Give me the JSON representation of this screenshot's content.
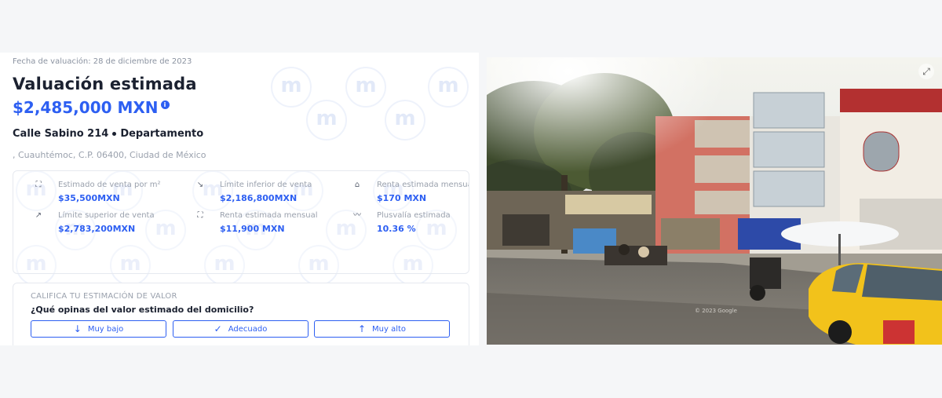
{
  "valuation": {
    "date_label": "Fecha de valuación: 28 de diciembre de 2023",
    "title": "Valuación estimada",
    "price": "$2,485,000 MXN",
    "info_icon": "i"
  },
  "property": {
    "street": "Calle Sabino 214",
    "type": "Departamento",
    "location": ", Cuauhtémoc, C.P. 06400, Ciudad de México"
  },
  "stats": [
    {
      "icon": "scan-icon",
      "glyph": "⛶",
      "label": "Estimado de venta por m²",
      "value": "$35,500MXN"
    },
    {
      "icon": "trend-down-icon",
      "glyph": "↘",
      "label": "Límite inferior de venta",
      "value": "$2,186,800MXN"
    },
    {
      "icon": "home-icon",
      "glyph": "⌂",
      "label": "Renta estimada mensual",
      "value": "$170 MXN"
    },
    {
      "icon": "trend-up-icon",
      "glyph": "↗",
      "label": "Límite superior de venta",
      "value": "$2,783,200MXN"
    },
    {
      "icon": "scan-icon",
      "glyph": "⛶",
      "label": "Renta estimada mensual",
      "value": "$11,900 MXN"
    },
    {
      "icon": "chart-icon",
      "glyph": "〰",
      "label": "Plusvalía estimada",
      "value": "10.36 %"
    }
  ],
  "rating": {
    "title": "CALIFICA TU ESTIMACIÓN DE VALOR",
    "question": "¿Qué opinas del valor estimado del domicilio?",
    "buttons": [
      {
        "label": "Muy bajo",
        "glyph": "↓"
      },
      {
        "label": "Adecuado",
        "glyph": "✓"
      },
      {
        "label": "Muy alto",
        "glyph": "↑"
      }
    ]
  },
  "photo": {
    "watermark": "© 2023 Google",
    "expand_glyph": "⤢"
  },
  "colors": {
    "accent": "#2d5ff2",
    "text_dark": "#1b2130",
    "text_muted": "#9aa1ad"
  }
}
